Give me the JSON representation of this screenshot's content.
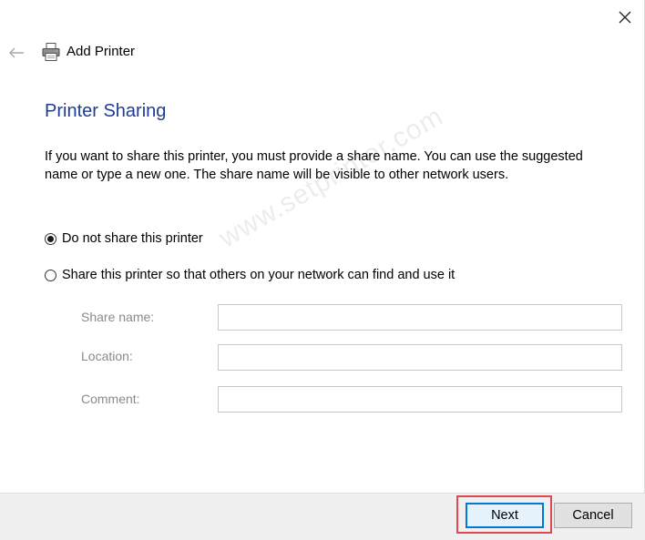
{
  "window": {
    "title": "Add Printer",
    "close_icon": "close-icon",
    "back_icon": "back-arrow-icon",
    "app_icon": "printer-icon"
  },
  "page": {
    "title": "Printer Sharing",
    "description": "If you want to share this printer, you must provide a share name. You can use the suggested name or type a new one. The share name will be visible to other network users."
  },
  "options": [
    {
      "label": "Do not share this printer",
      "checked": true
    },
    {
      "label": "Share this printer so that others on your network can find and use it",
      "checked": false
    }
  ],
  "fields": {
    "share_name": {
      "label": "Share name:",
      "value": ""
    },
    "location": {
      "label": "Location:",
      "value": ""
    },
    "comment": {
      "label": "Comment:",
      "value": ""
    }
  },
  "watermark": "www.setprinter.com",
  "footer": {
    "next_label": "Next",
    "cancel_label": "Cancel"
  },
  "colors": {
    "title_blue": "#1e3c96",
    "accent": "#0078d7",
    "highlight": "#e0494f"
  }
}
